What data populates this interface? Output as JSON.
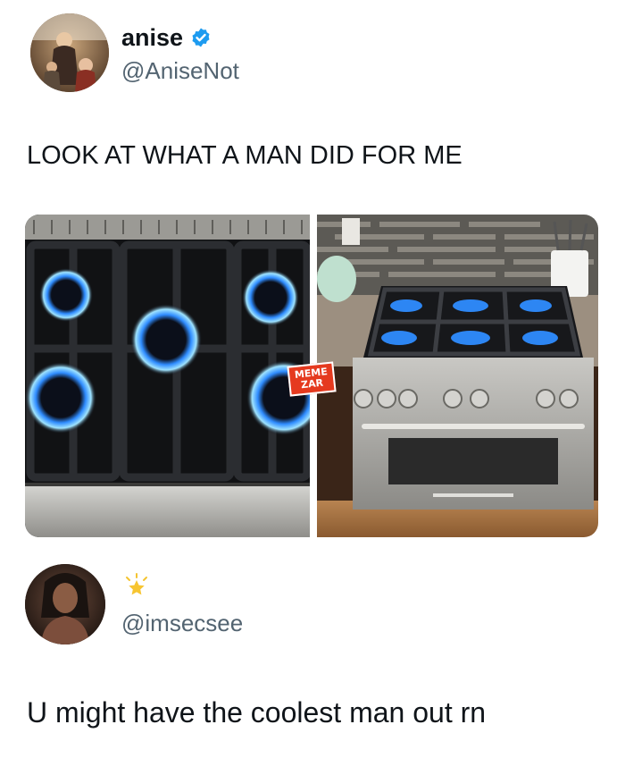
{
  "tweet": {
    "display_name": "anise",
    "handle": "@AniseNot",
    "verified": true,
    "text": "LOOK AT WHAT A MAN DID FOR ME",
    "media": [
      {
        "subject": "stovetop-closeup"
      },
      {
        "subject": "range-oven-kitchen"
      }
    ],
    "watermark_lines": [
      "MEME",
      "ZAR"
    ]
  },
  "reply": {
    "handle": "@imsecsee",
    "badge_icon": "sparkle-star-icon",
    "text": "U might have the coolest man out rn"
  },
  "colors": {
    "verified_blue": "#1d9bf0",
    "handle_gray": "#536471",
    "flame_blue": "#2f8cff"
  }
}
